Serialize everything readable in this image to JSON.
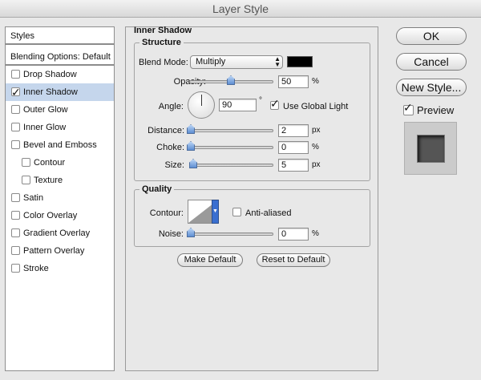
{
  "window": {
    "title": "Layer Style"
  },
  "sidebar": {
    "header": "Styles",
    "blending_options": "Blending Options: Default",
    "items": [
      {
        "label": "Drop Shadow",
        "checked": false
      },
      {
        "label": "Inner Shadow",
        "checked": true,
        "selected": true
      },
      {
        "label": "Outer Glow",
        "checked": false
      },
      {
        "label": "Inner Glow",
        "checked": false
      },
      {
        "label": "Bevel and Emboss",
        "checked": false
      },
      {
        "label": "Contour",
        "checked": false,
        "indent": true
      },
      {
        "label": "Texture",
        "checked": false,
        "indent": true
      },
      {
        "label": "Satin",
        "checked": false
      },
      {
        "label": "Color Overlay",
        "checked": false
      },
      {
        "label": "Gradient Overlay",
        "checked": false
      },
      {
        "label": "Pattern Overlay",
        "checked": false
      },
      {
        "label": "Stroke",
        "checked": false
      }
    ]
  },
  "inner_shadow": {
    "title": "Inner Shadow",
    "structure": {
      "title": "Structure",
      "blend_mode_label": "Blend Mode:",
      "blend_mode_value": "Multiply",
      "shadow_color": "#000000",
      "opacity_label": "Opacity:",
      "opacity_value": "50",
      "opacity_unit": "%",
      "opacity_fraction": 0.5,
      "angle_label": "Angle:",
      "angle_value": "90",
      "angle_unit": "°",
      "use_global_light_label": "Use Global Light",
      "use_global_light": true,
      "distance_label": "Distance:",
      "distance_value": "2",
      "distance_unit": "px",
      "choke_label": "Choke:",
      "choke_value": "0",
      "choke_unit": "%",
      "size_label": "Size:",
      "size_value": "5",
      "size_unit": "px"
    },
    "quality": {
      "title": "Quality",
      "contour_label": "Contour:",
      "anti_aliased_label": "Anti-aliased",
      "anti_aliased": false,
      "noise_label": "Noise:",
      "noise_value": "0",
      "noise_unit": "%"
    },
    "make_default_label": "Make Default",
    "reset_default_label": "Reset to Default"
  },
  "actions": {
    "ok_label": "OK",
    "cancel_label": "Cancel",
    "new_style_label": "New Style...",
    "preview_label": "Preview",
    "preview_checked": true
  }
}
